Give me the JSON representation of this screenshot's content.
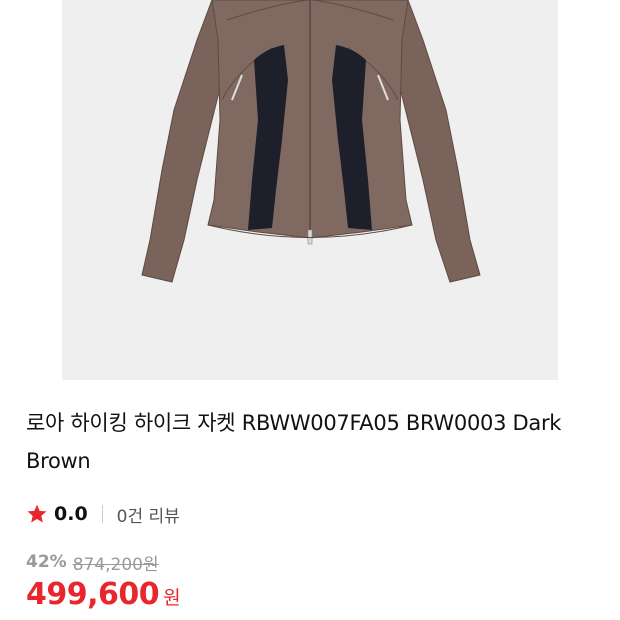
{
  "product": {
    "image_alt": "jacket-product-photo",
    "title": "로아 하이킹 하이크 자켓 RBWW007FA05 BRW0003 Dark Brown"
  },
  "rating": {
    "star_icon": "star-icon",
    "star_color": "#e8262c",
    "value": "0.0",
    "review_count": "0건 리뷰"
  },
  "price": {
    "discount_rate": "42%",
    "original": "874,200원",
    "final": "499,600",
    "currency": "원",
    "accent_color": "#e8262c"
  }
}
